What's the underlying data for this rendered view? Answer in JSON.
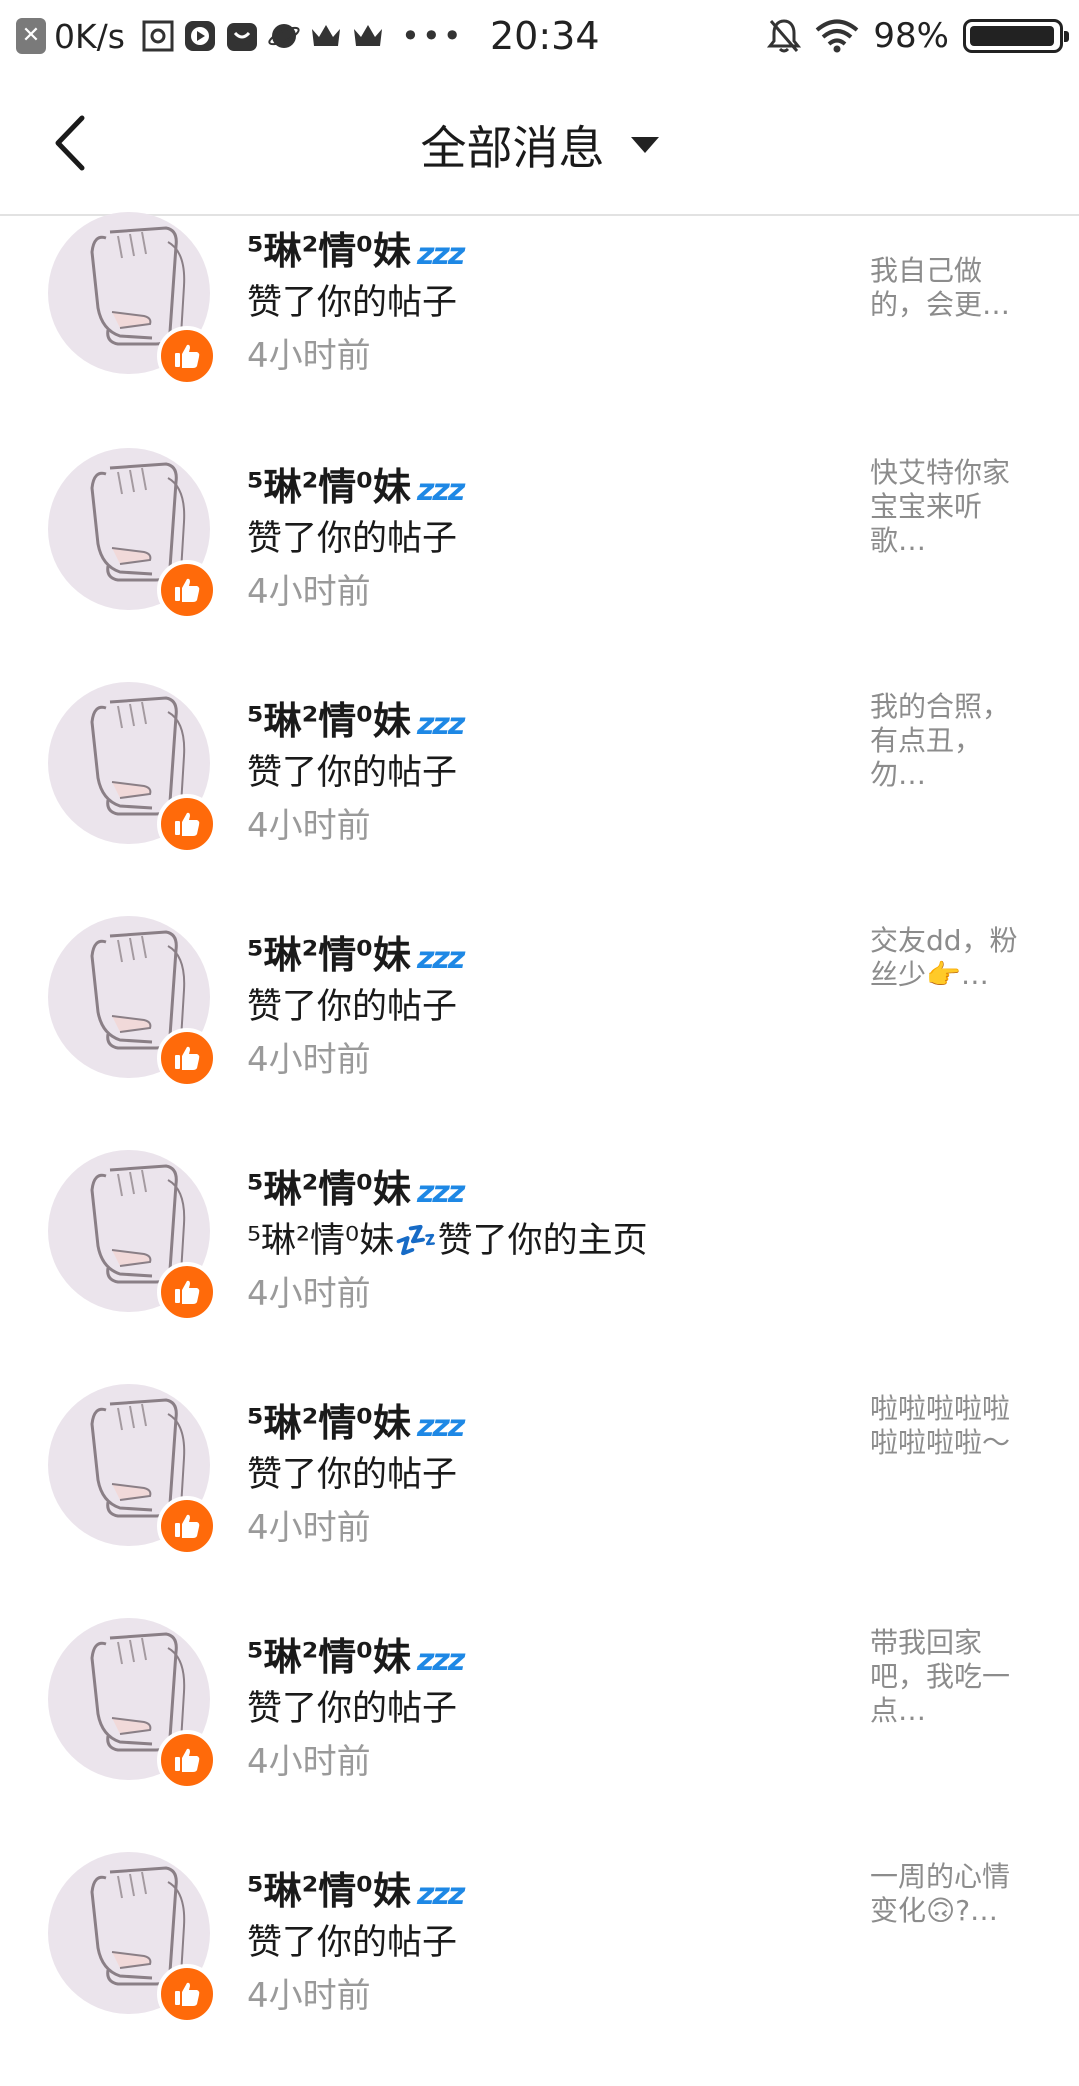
{
  "status_bar": {
    "net_speed": "0K/s",
    "time": "20:34",
    "battery": "98%"
  },
  "header": {
    "title": "全部消息"
  },
  "messages": [
    {
      "name": "⁵琳²情⁰妹",
      "zz": "zzz",
      "action": "赞了你的帖子",
      "time": "4小时前",
      "preview": "我自己做的，会更…"
    },
    {
      "name": "⁵琳²情⁰妹",
      "zz": "zzz",
      "action": "赞了你的帖子",
      "time": "4小时前",
      "preview": "快艾特你家宝宝来听歌…"
    },
    {
      "name": "⁵琳²情⁰妹",
      "zz": "zzz",
      "action": "赞了你的帖子",
      "time": "4小时前",
      "preview": "我的合照，有点丑，勿…"
    },
    {
      "name": "⁵琳²情⁰妹",
      "zz": "zzz",
      "action": "赞了你的帖子",
      "time": "4小时前",
      "preview": "交友dd，粉丝少👉…"
    },
    {
      "name": "⁵琳²情⁰妹",
      "zz": "zzz",
      "action": "⁵琳²情⁰妹💤赞了你的主页",
      "time": "4小时前",
      "preview": ""
    },
    {
      "name": "⁵琳²情⁰妹",
      "zz": "zzz",
      "action": "赞了你的帖子",
      "time": "4小时前",
      "preview": "啦啦啦啦啦啦啦啦啦～"
    },
    {
      "name": "⁵琳²情⁰妹",
      "zz": "zzz",
      "action": "赞了你的帖子",
      "time": "4小时前",
      "preview": "带我回家吧，我吃一点…"
    },
    {
      "name": "⁵琳²情⁰妹",
      "zz": "zzz",
      "action": "赞了你的帖子",
      "time": "4小时前",
      "preview": "一周的心情变化🙃?…"
    }
  ],
  "colors": {
    "badge": "#ff6a0a",
    "zz": "#1e88e5",
    "muted": "#9a9a9a"
  }
}
